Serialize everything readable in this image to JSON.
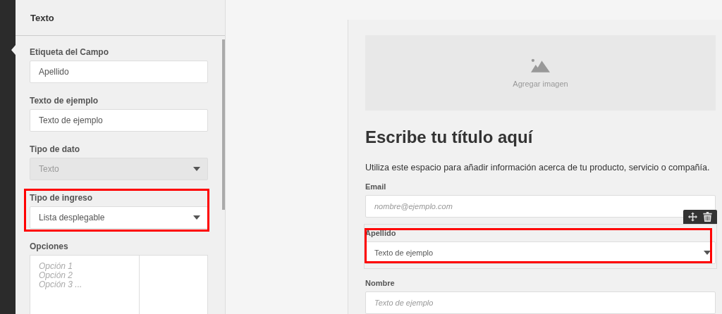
{
  "panel": {
    "title": "Texto",
    "fields": [
      {
        "kind": "text",
        "label": "Etiqueta del Campo",
        "value": "Apellido",
        "highlighted": false,
        "disabled": false
      },
      {
        "kind": "text",
        "label": "Texto de ejemplo",
        "value": "Texto de ejemplo",
        "highlighted": false,
        "disabled": false
      },
      {
        "kind": "select",
        "label": "Tipo de dato",
        "value": "Texto",
        "highlighted": false,
        "disabled": true
      },
      {
        "kind": "select",
        "label": "Tipo de ingreso",
        "value": "Lista desplegable",
        "highlighted": true,
        "disabled": false
      },
      {
        "kind": "textarea",
        "label": "Opciones",
        "placeholder": "Opción 1\nOpción 2\nOpción 3 ...",
        "highlighted": false,
        "disabled": false
      }
    ]
  },
  "form": {
    "image_placeholder": "Agregar imagen",
    "title": "Escribe tu título aquí",
    "description": "Utiliza este espacio para añadir información acerca de tu producto, servicio o compañía.",
    "fields": [
      {
        "kind": "text",
        "label": "Email",
        "placeholder": "nombre@ejemplo.com",
        "selected": false,
        "highlighted": false
      },
      {
        "kind": "select",
        "label": "Apellido",
        "value": "Texto de ejemplo",
        "selected": true,
        "highlighted": true
      },
      {
        "kind": "text",
        "label": "Nombre",
        "placeholder": "Texto de ejemplo",
        "selected": false,
        "highlighted": false
      }
    ]
  }
}
